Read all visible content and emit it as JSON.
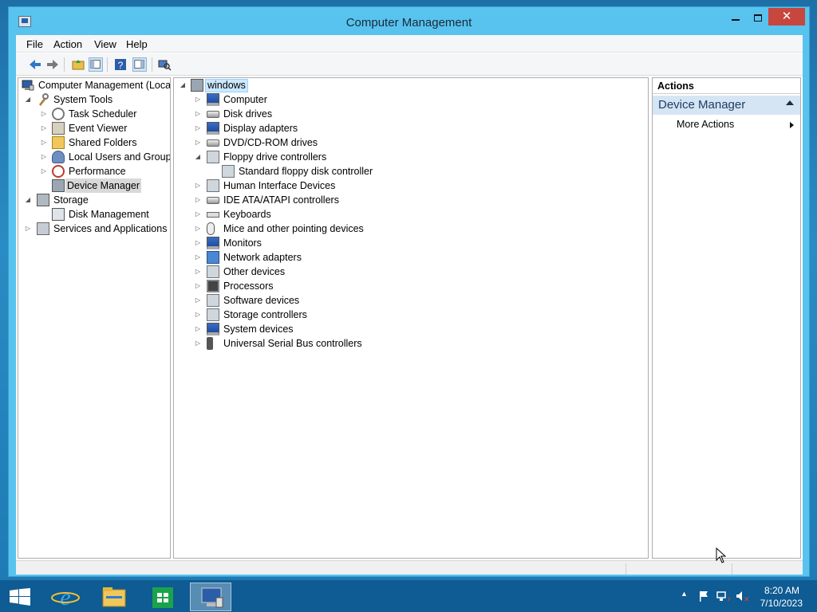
{
  "window": {
    "title": "Computer Management"
  },
  "menu": [
    "File",
    "Action",
    "View",
    "Help"
  ],
  "left_tree": [
    {
      "label": "Computer Management (Local",
      "icon": "computer-management-icon",
      "level": 0,
      "expanded": true
    },
    {
      "label": "System Tools",
      "icon": "system-tools-icon",
      "level": 1,
      "expanded": true
    },
    {
      "label": "Task Scheduler",
      "icon": "clock-icon",
      "level": 2,
      "expandable": true
    },
    {
      "label": "Event Viewer",
      "icon": "event-viewer-icon",
      "level": 2,
      "expandable": true
    },
    {
      "label": "Shared Folders",
      "icon": "shared-folder-icon",
      "level": 2,
      "expandable": true
    },
    {
      "label": "Local Users and Groups",
      "icon": "users-icon",
      "level": 2,
      "expandable": true
    },
    {
      "label": "Performance",
      "icon": "performance-icon",
      "level": 2,
      "expandable": true
    },
    {
      "label": "Device Manager",
      "icon": "device-manager-icon",
      "level": 2,
      "selected": true
    },
    {
      "label": "Storage",
      "icon": "storage-icon",
      "level": 1,
      "expanded": true
    },
    {
      "label": "Disk Management",
      "icon": "disk-icon",
      "level": 2
    },
    {
      "label": "Services and Applications",
      "icon": "services-icon",
      "level": 1,
      "expandable": true
    }
  ],
  "device_tree": {
    "root": "windows",
    "items": [
      {
        "label": "Computer",
        "icon": "computer-icon"
      },
      {
        "label": "Disk drives",
        "icon": "disk-drive-icon"
      },
      {
        "label": "Display adapters",
        "icon": "display-adapter-icon"
      },
      {
        "label": "DVD/CD-ROM drives",
        "icon": "dvd-drive-icon"
      },
      {
        "label": "Floppy drive controllers",
        "icon": "floppy-controller-icon",
        "expanded": true
      },
      {
        "label": "Standard floppy disk controller",
        "icon": "floppy-controller-icon",
        "child": true
      },
      {
        "label": "Human Interface Devices",
        "icon": "hid-icon"
      },
      {
        "label": "IDE ATA/ATAPI controllers",
        "icon": "ide-controller-icon"
      },
      {
        "label": "Keyboards",
        "icon": "keyboard-icon"
      },
      {
        "label": "Mice and other pointing devices",
        "icon": "mouse-icon"
      },
      {
        "label": "Monitors",
        "icon": "monitor-icon"
      },
      {
        "label": "Network adapters",
        "icon": "network-adapter-icon"
      },
      {
        "label": "Other devices",
        "icon": "other-devices-icon"
      },
      {
        "label": "Processors",
        "icon": "processor-icon"
      },
      {
        "label": "Software devices",
        "icon": "software-device-icon"
      },
      {
        "label": "Storage controllers",
        "icon": "storage-controller-icon"
      },
      {
        "label": "System devices",
        "icon": "system-devices-icon"
      },
      {
        "label": "Universal Serial Bus controllers",
        "icon": "usb-icon"
      }
    ]
  },
  "actions": {
    "header": "Actions",
    "section": "Device Manager",
    "item": "More Actions"
  },
  "taskbar": {
    "time": "8:20 AM",
    "date": "7/10/2023"
  },
  "colors": {
    "titlebar": "#58c3ef",
    "close_button": "#c7463d",
    "taskbar": "#0f5b93",
    "actions_section": "#d6e5f3"
  }
}
